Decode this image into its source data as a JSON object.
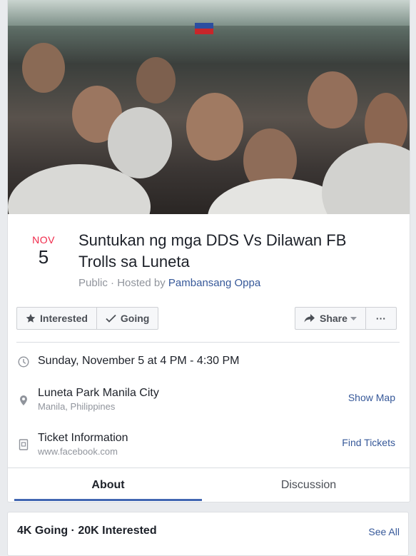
{
  "event": {
    "month": "NOV",
    "day": "5",
    "title": "Suntukan ng mga DDS Vs Dilawan FB Trolls sa Luneta",
    "privacy": "Public",
    "hosted_by_prefix": "Hosted by",
    "host": "Pambansang Oppa"
  },
  "actions": {
    "interested": "Interested",
    "going": "Going",
    "share": "Share",
    "more": "···"
  },
  "details": {
    "time": "Sunday, November 5 at 4 PM - 4:30 PM",
    "place_name": "Luneta Park Manila City",
    "place_city": "Manila, Philippines",
    "show_map": "Show Map",
    "ticket_title": "Ticket Information",
    "ticket_url": "www.facebook.com",
    "find_tickets": "Find Tickets"
  },
  "tabs": [
    {
      "label": "About",
      "active": true
    },
    {
      "label": "Discussion",
      "active": false
    }
  ],
  "attendance": {
    "summary": "4K Going · 20K Interested",
    "see_all": "See All"
  },
  "colors": {
    "accent": "#4267b2",
    "link": "#365899",
    "date_month": "#f02849"
  },
  "icons": [
    "star-icon",
    "check-icon",
    "share-arrow-icon",
    "caret-down-icon",
    "clock-icon",
    "location-pin-icon",
    "ticket-icon"
  ]
}
